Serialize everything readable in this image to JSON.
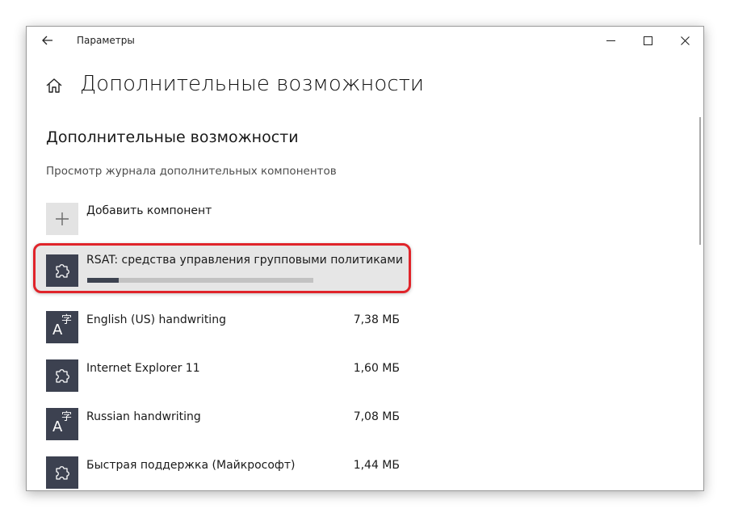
{
  "window": {
    "app_title": "Параметры",
    "back_icon": "arrow-left-icon",
    "minimize_icon": "minimize-icon",
    "maximize_icon": "maximize-icon",
    "close_icon": "close-icon"
  },
  "header": {
    "home_icon": "home-icon",
    "page_title": "Дополнительные возможности"
  },
  "section": {
    "title": "Дополнительные возможности",
    "history_link": "Просмотр журнала дополнительных компонентов",
    "add_label": "Добавить компонент",
    "add_icon": "plus-icon"
  },
  "installing": {
    "name": "RSAT: средства управления групповыми политиками",
    "icon": "puzzle-icon",
    "progress": 0.14,
    "highlight_color": "#e0242a"
  },
  "features": [
    {
      "name": "English (US) handwriting",
      "size": "7,38 МБ",
      "icon": "handwriting-icon"
    },
    {
      "name": "Internet Explorer 11",
      "size": "1,60 МБ",
      "icon": "puzzle-icon"
    },
    {
      "name": "Russian handwriting",
      "size": "7,08 МБ",
      "icon": "handwriting-icon"
    },
    {
      "name": "Быстрая поддержка (Майкрософт)",
      "size": "1,44 МБ",
      "icon": "puzzle-icon"
    }
  ],
  "colors": {
    "tile_dark": "#3c4150",
    "tile_light": "#e3e3e3",
    "progress_fill": "#3d4350",
    "progress_track": "#c2c2c2"
  }
}
